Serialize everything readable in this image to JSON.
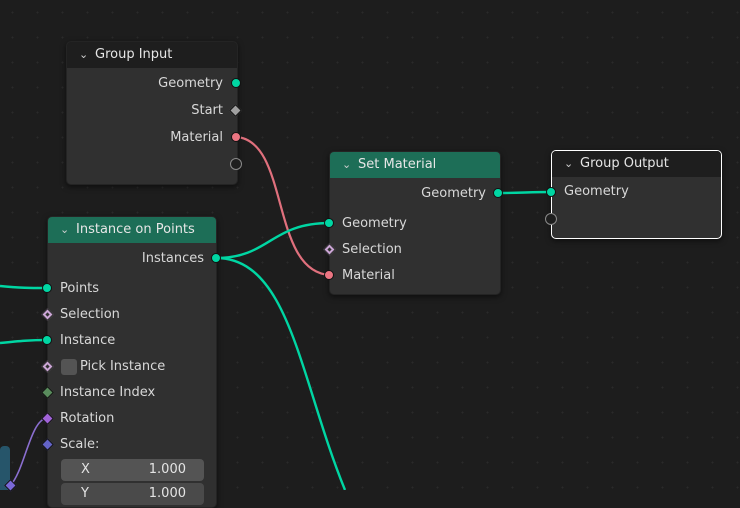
{
  "nodes": {
    "group_input": {
      "title": "Group Input",
      "outputs": [
        "Geometry",
        "Start",
        "Material"
      ]
    },
    "set_material": {
      "title": "Set Material",
      "output": "Geometry",
      "inputs": [
        "Geometry",
        "Selection",
        "Material"
      ]
    },
    "group_output": {
      "title": "Group Output",
      "input": "Geometry"
    },
    "instance_on_points": {
      "title": "Instance on Points",
      "output": "Instances",
      "inputs": [
        "Points",
        "Selection",
        "Instance",
        "Pick Instance",
        "Instance Index",
        "Rotation",
        "Scale:"
      ],
      "scale": {
        "x_label": "X",
        "x_value": "1.000",
        "y_label": "Y",
        "y_value": "1.000"
      }
    }
  },
  "colors": {
    "geometry_socket": "#00d6a3",
    "material_socket": "#eb7582",
    "header_green": "#1d6e57",
    "header_dark": "#1e1e1e",
    "node_body": "#303030",
    "canvas": "#1d1d1d"
  },
  "icons": {
    "collapse": "chevron-down-icon"
  }
}
